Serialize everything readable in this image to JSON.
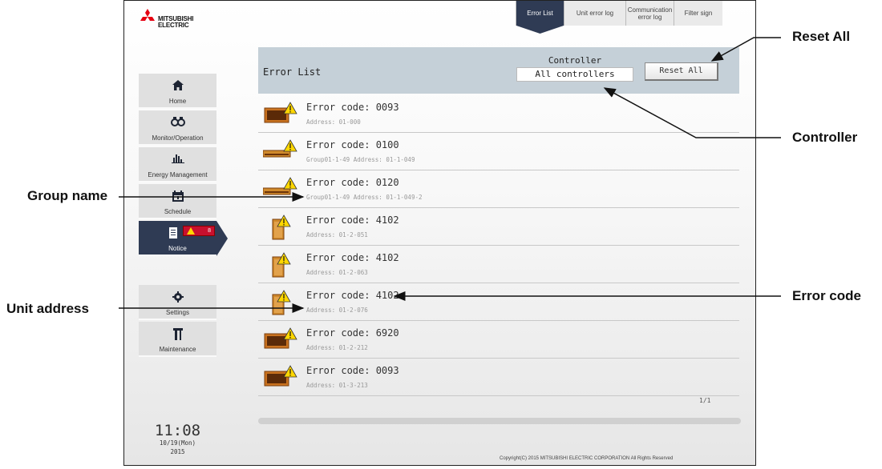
{
  "brand": {
    "line1": "MITSUBISHI",
    "line2": "ELECTRIC",
    "logo_color": "#e60012"
  },
  "tabs": [
    {
      "label": "Error List",
      "active": true
    },
    {
      "label": "Unit error log",
      "active": false
    },
    {
      "label": "Communication error log",
      "active": false
    },
    {
      "label": "Filter sign",
      "active": false
    }
  ],
  "sidebar": {
    "items": [
      {
        "label": "Home",
        "icon": "home-icon"
      },
      {
        "label": "Monitor/Operation",
        "icon": "binoculars-icon"
      },
      {
        "label": "Energy Management",
        "icon": "bar-chart-icon"
      },
      {
        "label": "Schedule",
        "icon": "calendar-icon"
      },
      {
        "label": "Notice",
        "icon": "notice-icon",
        "active": true,
        "badge_count": "8"
      },
      {
        "label": "Settings",
        "icon": "gear-icon"
      },
      {
        "label": "Maintenance",
        "icon": "tools-icon"
      }
    ]
  },
  "clock": {
    "time": "11:08",
    "date": "10/19(Mon)",
    "year": "2015"
  },
  "main": {
    "title": "Error List",
    "controller_label": "Controller",
    "controller_value": "All controllers",
    "reset_all_label": "Reset All",
    "errors": [
      {
        "code": "Error code: 0093",
        "address": "Address: 01-000",
        "unit_icon": "outdoor-unit-icon"
      },
      {
        "code": "Error code: 0100",
        "address": "Group01-1-49   Address: 01-1-049",
        "unit_icon": "indoor-unit-icon"
      },
      {
        "code": "Error code: 0120",
        "address": "Group01-1-49   Address: 01-1-049-2",
        "unit_icon": "indoor-unit-icon"
      },
      {
        "code": "Error code: 4102",
        "address": "Address: 01-2-051",
        "unit_icon": "door-unit-icon"
      },
      {
        "code": "Error code: 4102",
        "address": "Address: 01-2-063",
        "unit_icon": "door-unit-icon"
      },
      {
        "code": "Error code: 4102",
        "address": "Address: 01-2-076",
        "unit_icon": "door-unit-icon"
      },
      {
        "code": "Error code: 6920",
        "address": "Address: 01-2-212",
        "unit_icon": "outdoor-unit-icon"
      },
      {
        "code": "Error code: 0093",
        "address": "Address: 01-3-213",
        "unit_icon": "outdoor-unit-icon"
      }
    ],
    "page_indicator": "1/1"
  },
  "footer": {
    "copyright": "Copyright(C) 2015 MITSUBISHI ELECTRIC CORPORATION All Rights Reserved"
  },
  "annotations": {
    "reset_all": "Reset All",
    "controller": "Controller",
    "group_name": "Group name",
    "error_code": "Error code",
    "unit_address": "Unit address"
  },
  "colors": {
    "nav_active": "#2f3b54",
    "header_bar": "#c5d0d8",
    "badge": "#c8102e",
    "warning": "#ffd700"
  }
}
